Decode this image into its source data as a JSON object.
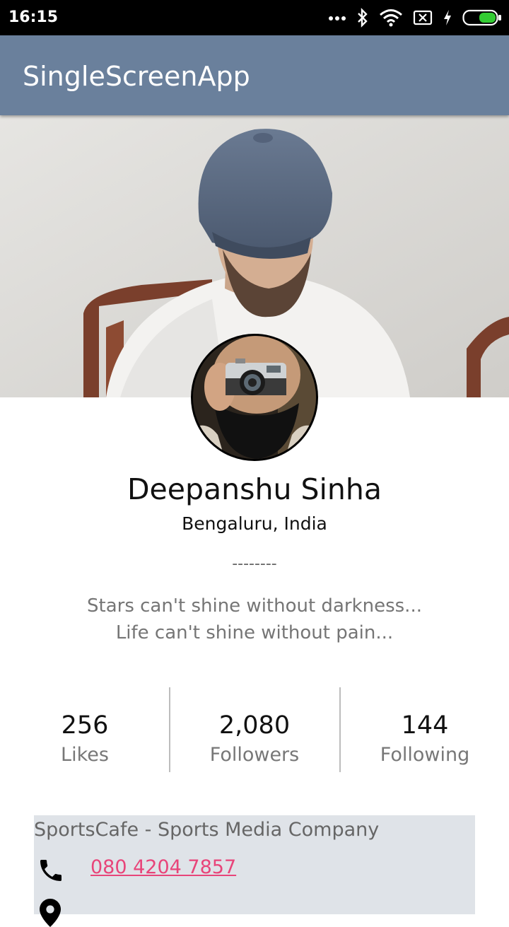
{
  "status_bar": {
    "time": "16:15",
    "icons": [
      "more-dots-icon",
      "bluetooth-icon",
      "wifi-icon",
      "no-sim-icon",
      "charging-icon",
      "battery-icon"
    ],
    "battery_color": "#33cc33"
  },
  "app_bar": {
    "title": "SingleScreenApp",
    "color": "#6a809c"
  },
  "profile": {
    "name": "Deepanshu Sinha",
    "location": "Bengaluru, India",
    "divider": "--------",
    "quote_line1": "Stars can't shine without darkness...",
    "quote_line2": "Life can't shine without pain..."
  },
  "stats": [
    {
      "value": "256",
      "label": "Likes"
    },
    {
      "value": "2,080",
      "label": "Followers"
    },
    {
      "value": "144",
      "label": "Following"
    }
  ],
  "contact": {
    "company": "SportsCafe - Sports Media Company",
    "phone": "080 4204 7857",
    "link_color": "#e8457a",
    "icons": [
      "phone-icon",
      "location-pin-icon"
    ]
  }
}
